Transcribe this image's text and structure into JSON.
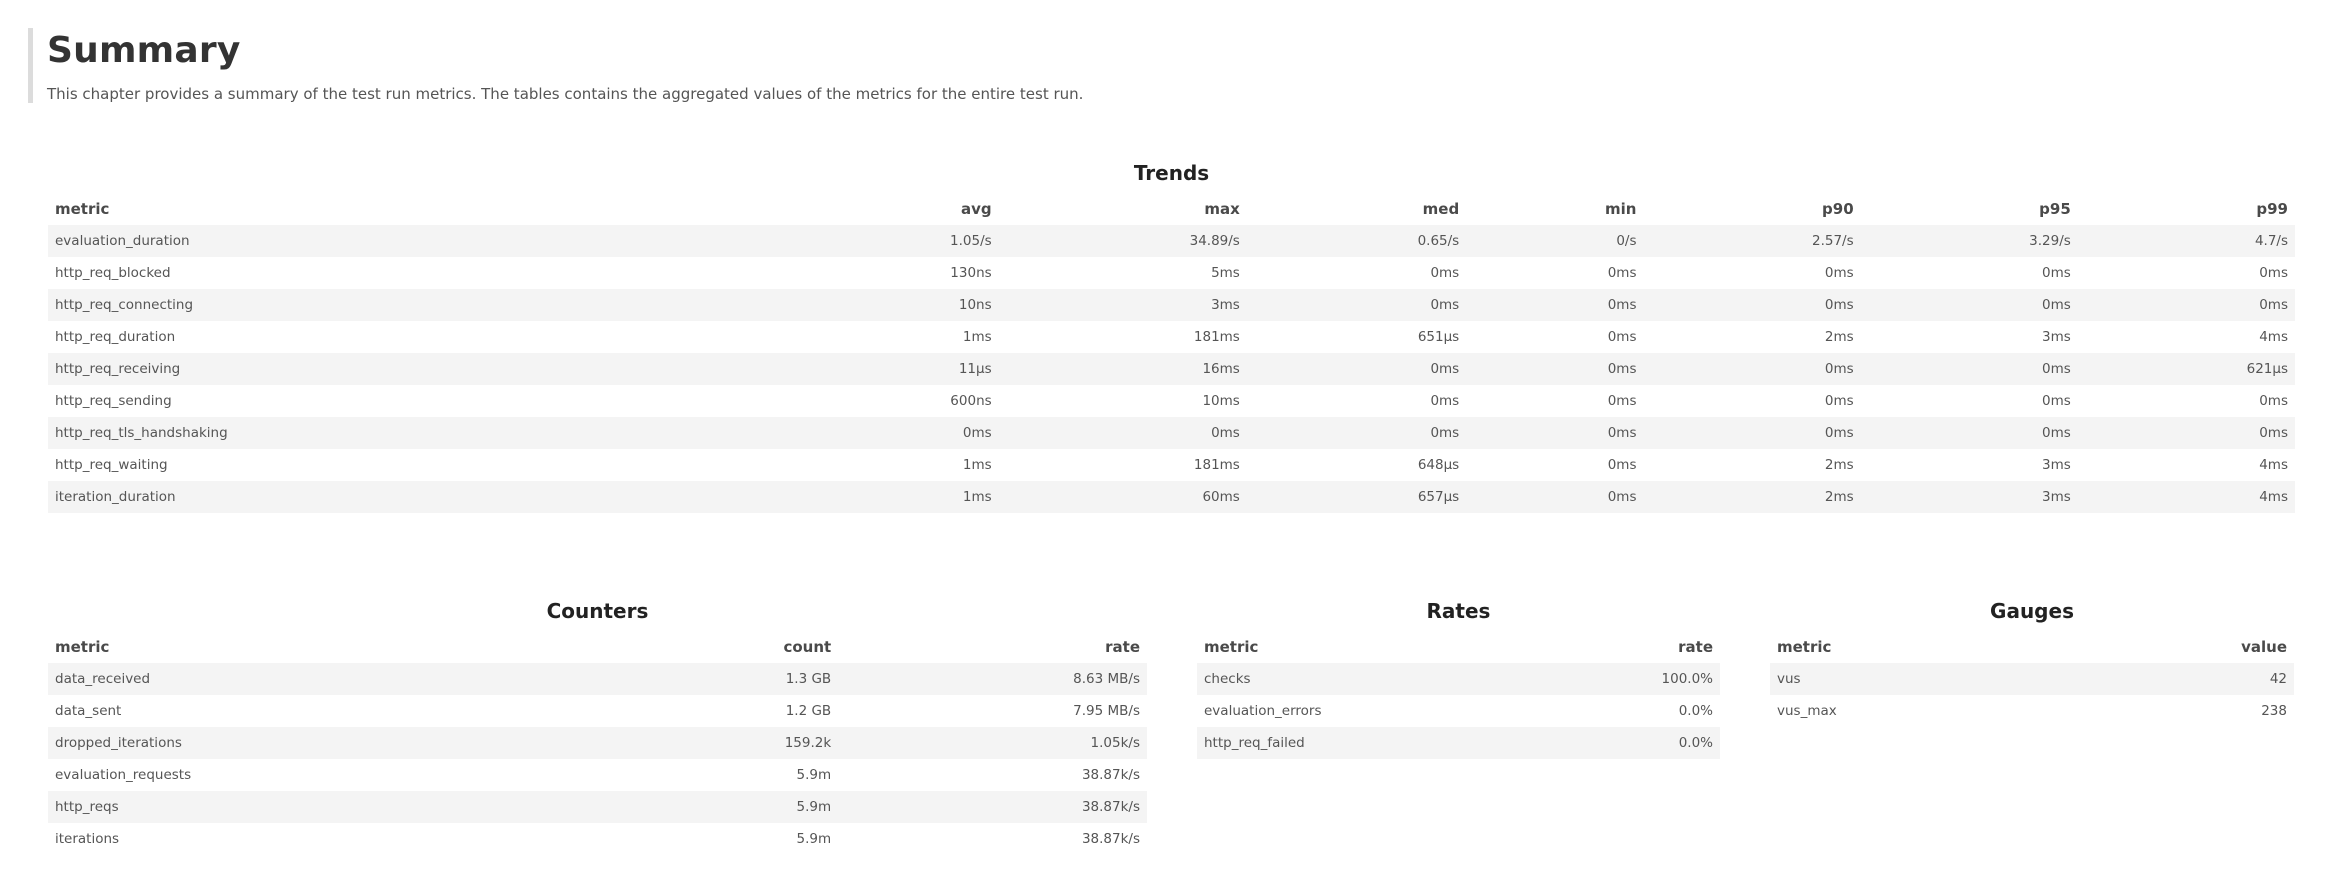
{
  "summary": {
    "title": "Summary",
    "description": "This chapter provides a summary of the test run metrics. The tables contains the aggregated values of the metrics for the entire test run."
  },
  "trends": {
    "title": "Trends",
    "columns": [
      "metric",
      "avg",
      "max",
      "med",
      "min",
      "p90",
      "p95",
      "p99"
    ],
    "rows": [
      [
        "evaluation_duration",
        "1.05/s",
        "34.89/s",
        "0.65/s",
        "0/s",
        "2.57/s",
        "3.29/s",
        "4.7/s"
      ],
      [
        "http_req_blocked",
        "130ns",
        "5ms",
        "0ms",
        "0ms",
        "0ms",
        "0ms",
        "0ms"
      ],
      [
        "http_req_connecting",
        "10ns",
        "3ms",
        "0ms",
        "0ms",
        "0ms",
        "0ms",
        "0ms"
      ],
      [
        "http_req_duration",
        "1ms",
        "181ms",
        "651µs",
        "0ms",
        "2ms",
        "3ms",
        "4ms"
      ],
      [
        "http_req_receiving",
        "11µs",
        "16ms",
        "0ms",
        "0ms",
        "0ms",
        "0ms",
        "621µs"
      ],
      [
        "http_req_sending",
        "600ns",
        "10ms",
        "0ms",
        "0ms",
        "0ms",
        "0ms",
        "0ms"
      ],
      [
        "http_req_tls_handshaking",
        "0ms",
        "0ms",
        "0ms",
        "0ms",
        "0ms",
        "0ms",
        "0ms"
      ],
      [
        "http_req_waiting",
        "1ms",
        "181ms",
        "648µs",
        "0ms",
        "2ms",
        "3ms",
        "4ms"
      ],
      [
        "iteration_duration",
        "1ms",
        "60ms",
        "657µs",
        "0ms",
        "2ms",
        "3ms",
        "4ms"
      ]
    ]
  },
  "counters": {
    "title": "Counters",
    "columns": [
      "metric",
      "count",
      "rate"
    ],
    "rows": [
      [
        "data_received",
        "1.3 GB",
        "8.63 MB/s"
      ],
      [
        "data_sent",
        "1.2 GB",
        "7.95 MB/s"
      ],
      [
        "dropped_iterations",
        "159.2k",
        "1.05k/s"
      ],
      [
        "evaluation_requests",
        "5.9m",
        "38.87k/s"
      ],
      [
        "http_reqs",
        "5.9m",
        "38.87k/s"
      ],
      [
        "iterations",
        "5.9m",
        "38.87k/s"
      ]
    ]
  },
  "rates": {
    "title": "Rates",
    "columns": [
      "metric",
      "rate"
    ],
    "rows": [
      [
        "checks",
        "100.0%"
      ],
      [
        "evaluation_errors",
        "0.0%"
      ],
      [
        "http_req_failed",
        "0.0%"
      ]
    ]
  },
  "gauges": {
    "title": "Gauges",
    "columns": [
      "metric",
      "value"
    ],
    "rows": [
      [
        "vus",
        "42"
      ],
      [
        "vus_max",
        "238"
      ]
    ]
  }
}
